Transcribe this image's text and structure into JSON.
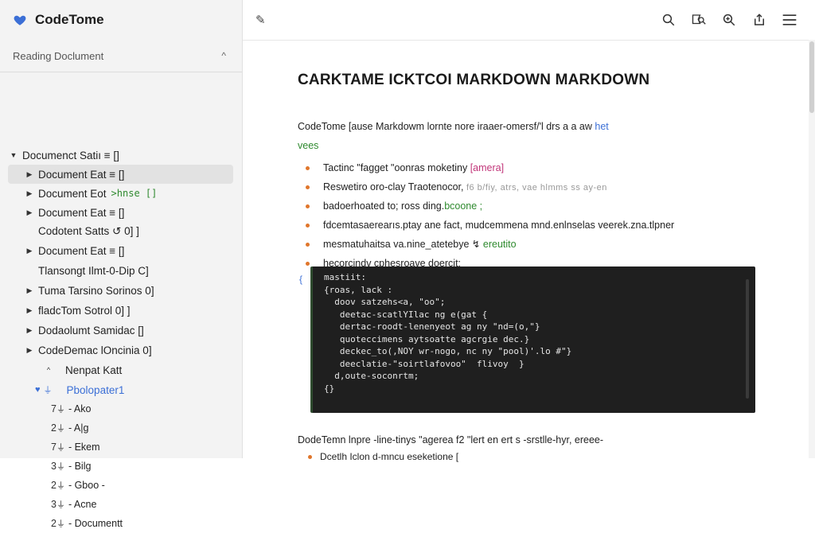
{
  "app": {
    "title": "CodeTome",
    "brand_color": "#3b6fd6"
  },
  "sidebar": {
    "section_title": "Reading Doclument",
    "section_toggle": "^",
    "items": [
      {
        "caret": "▼",
        "label": "Documenct Satiı ≡  [⁠]",
        "extra": "",
        "selected": false
      },
      {
        "caret": "▶",
        "label": "Document Eat ≡  [⁠]",
        "extra": "",
        "selected": true
      },
      {
        "caret": "▶",
        "label": "Document Eot",
        "extra": ">hnse [⁠]",
        "selected": false
      },
      {
        "caret": "▶",
        "label": "Document Eat ≡  [⁠]",
        "extra": "",
        "selected": false
      },
      {
        "caret": "",
        "label": "Codotent Satts ↺  0]    ⁠]",
        "extra": "",
        "selected": false
      },
      {
        "caret": "▶",
        "label": "Document Eat ≡  [⁠]",
        "extra": "",
        "selected": false
      },
      {
        "caret": "",
        "label": "Tlansongt Ilmt-0-Dip  C]",
        "extra": "",
        "selected": false
      },
      {
        "caret": "▶",
        "label": "Tuma Tarsino Sorinos  0]",
        "extra": "",
        "selected": false
      },
      {
        "caret": "▶",
        "label": "fladcTom Sotrol 0]   ⁠]",
        "extra": "",
        "selected": false
      },
      {
        "caret": "▶",
        "label": "Dodaolumt Samidac [⁠]",
        "extra": "",
        "selected": false
      },
      {
        "caret": "▶",
        "label": "CodeDemac lOncinia  0]",
        "extra": "",
        "selected": false
      },
      {
        "caret": "^",
        "label": "Nenpat Katt",
        "extra": "",
        "selected": false
      }
    ],
    "active": {
      "label": "Pbolopater1"
    },
    "subitems": [
      {
        "num": "7",
        "label": "- Ako"
      },
      {
        "num": "2",
        "label": "- A|g"
      },
      {
        "num": "7",
        "label": "- Ekem"
      },
      {
        "num": "3",
        "label": "- Bilg"
      },
      {
        "num": "2",
        "label": "- Gboo -"
      },
      {
        "num": "3",
        "label": "- Acne"
      },
      {
        "num": "2",
        "label": "- Documentt"
      }
    ]
  },
  "toolbar": {
    "edit_icon": "pen-icon",
    "icons": [
      "search-icon",
      "bookmark-icon",
      "zoom-icon",
      "share-icon",
      "menu-icon"
    ]
  },
  "document": {
    "title": "CARKTAME ICKTCOI MARKDOWN MARKDOWN",
    "intro_line1": "CodeTome [ause Markdowm lornte  nore  iraaer-omersf/'l  drs  a  ⁠a  aw",
    "intro_link": "het",
    "intro_line2": "vees",
    "bullets": [
      {
        "text": "Tactinc \"fagget \"oonras moketiny",
        "suffix": "[amera]",
        "suffix_color": "#c2367a"
      },
      {
        "text": "Reswetiro oro-clay Traotenocor,",
        "suffix": "f6 b/fiy, atrs, vae hlmms ⁠ss  ay-en",
        "suffix_color": "#999999"
      },
      {
        "text": "badoerhoated to; ross ding.",
        "suffix": "bcoone ;",
        "suffix_color": "#2f8a2f"
      },
      {
        "text": "fdcemtasaerearıs.ptay ane fact,  mudcemmena mnd.enlnselas veerek.zna.tlpner",
        "suffix": "",
        "suffix_color": "#222222"
      },
      {
        "text": "mesmatuhaitsa va.nine_atetebye ↯",
        "suffix": "ereutito",
        "suffix_color": "#2f8a2f"
      },
      {
        "text": "hecorcindv cphesroave doercit:",
        "suffix": "",
        "suffix_color": "#222222"
      }
    ],
    "code_side": "{",
    "code": "mastiit:\n{roas, lack :\n  doov satzehs<a, \"oo\";\n   deetac-scatlYIlac ng e(gat {\n   dertac-roodt-lenenyeot ag ny \"nd=(o,\"}\n   quoteccimens aytsoatte agcrgie dec.}\n   deckec_to(,NOY wr-nogo, nc ny \"pool)'.lo #\"}\n   deeclatie-\"soirtlafovoo\"  flivoy  }\n  d,oute-soconrtm;\n{}",
    "tail_line": "DodeTemn lnpre -line-tinys \"agerea f2  \"lert  en  ert  s -srstlle-hyr,  ereee-",
    "tail_line2": "Dcetlh Iclon  d-mncu  eseketione  ["
  }
}
